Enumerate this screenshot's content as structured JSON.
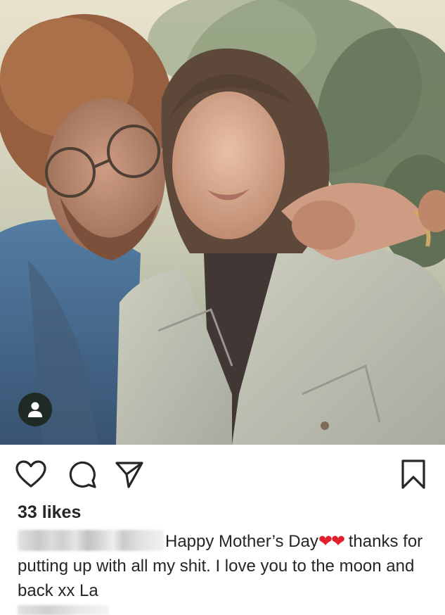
{
  "post": {
    "photo_description_icon": "photo-of-two-people",
    "tag_icon": "user-tag-icon"
  },
  "actions": {
    "like_icon": "heart-icon",
    "comment_icon": "comment-bubble-icon",
    "share_icon": "paper-plane-icon",
    "save_icon": "bookmark-icon"
  },
  "likes": {
    "text": "33 likes"
  },
  "caption": {
    "text": "Happy Mother’s Day",
    "emoji": "❤❤",
    "continuation": "thanks for putting up with all my shit. I love you to the moon and back xx La"
  },
  "colors": {
    "heart_red": "#e0202a",
    "text": "#262626",
    "tag_badge": "#1f2a24"
  }
}
